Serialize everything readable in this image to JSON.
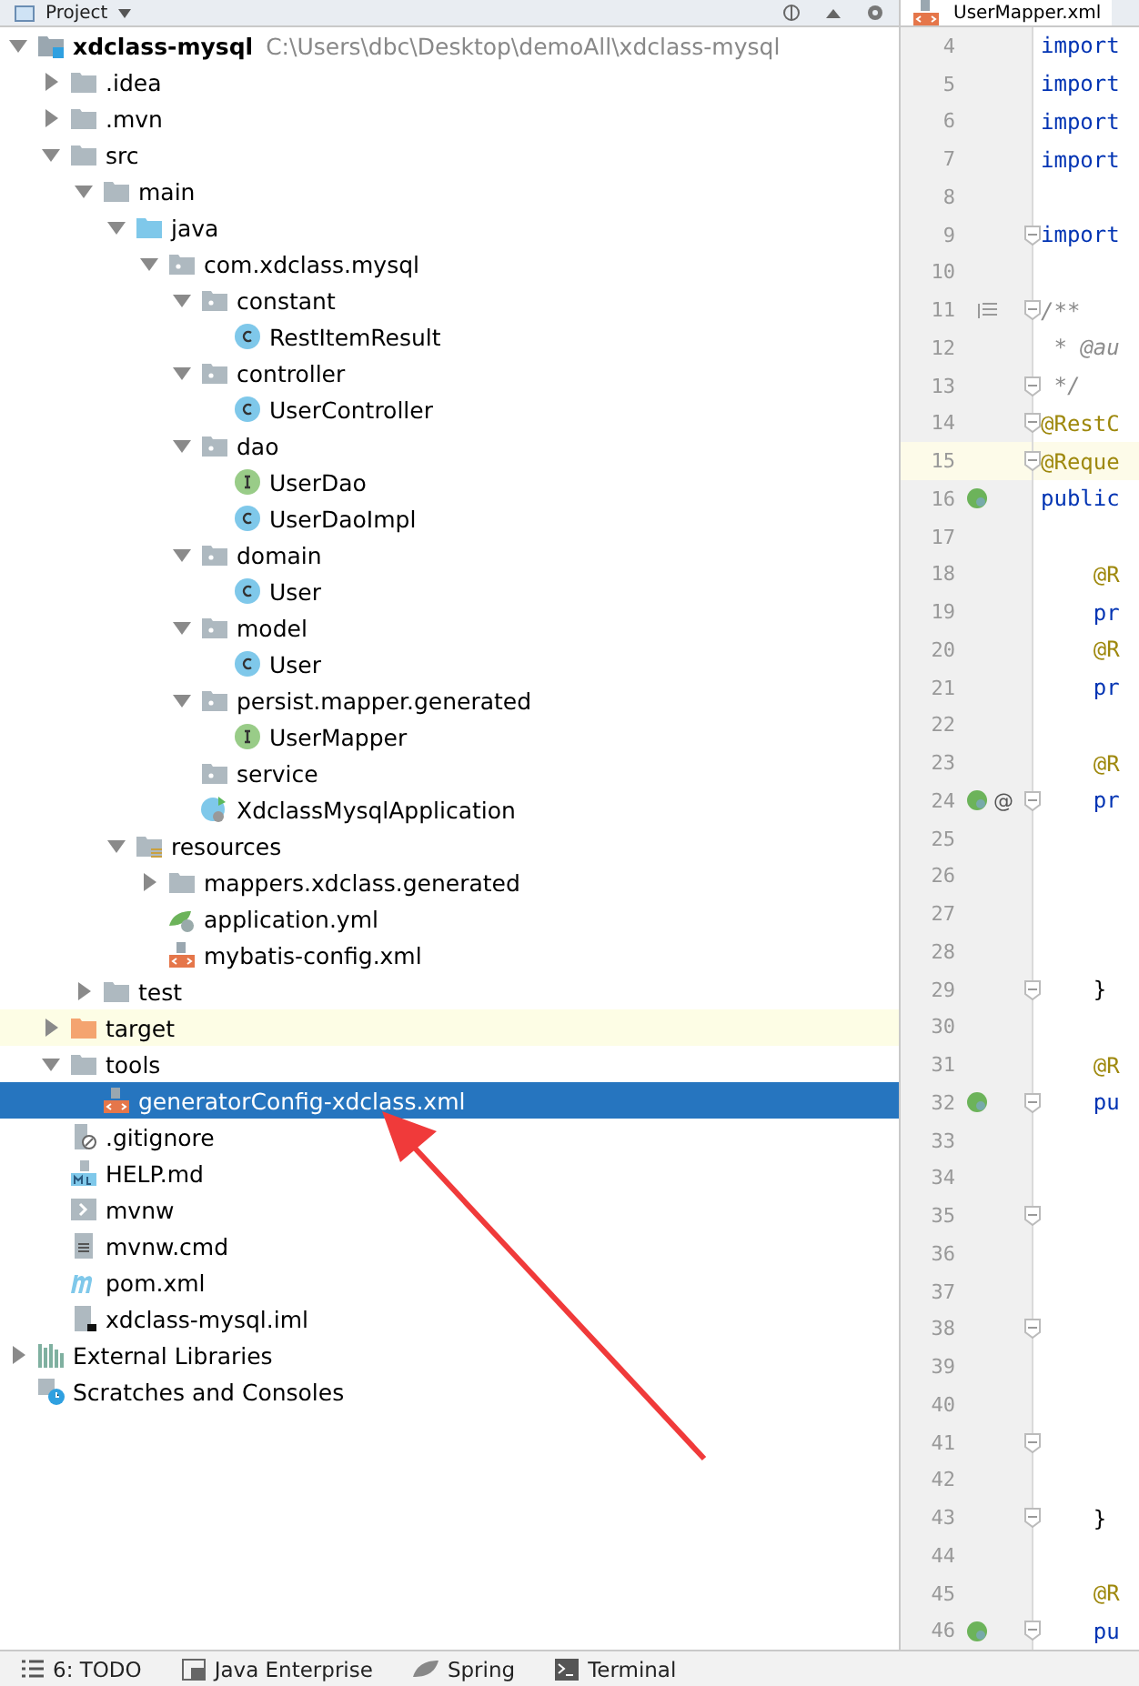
{
  "project_panel": {
    "title": "Project",
    "tree": [
      {
        "label": "xdclass-mysql",
        "path": "C:\\Users\\dbc\\Desktop\\demoAll\\xdclass-mysql",
        "kind": "module",
        "expanded": true,
        "selected": false,
        "highlighted": false,
        "children": [
          {
            "label": ".idea",
            "kind": "folder",
            "expanded": false,
            "selected": false,
            "highlighted": false
          },
          {
            "label": ".mvn",
            "kind": "folder",
            "expanded": false,
            "selected": false,
            "highlighted": false
          },
          {
            "label": "src",
            "kind": "folder",
            "expanded": true,
            "selected": false,
            "highlighted": false,
            "children": [
              {
                "label": "main",
                "kind": "folder",
                "expanded": true,
                "selected": false,
                "highlighted": false,
                "children": [
                  {
                    "label": "java",
                    "kind": "source-folder",
                    "expanded": true,
                    "selected": false,
                    "highlighted": false,
                    "children": [
                      {
                        "label": "com.xdclass.mysql",
                        "kind": "package",
                        "expanded": true,
                        "selected": false,
                        "highlighted": false,
                        "children": [
                          {
                            "label": "constant",
                            "kind": "package",
                            "expanded": true,
                            "selected": false,
                            "highlighted": false,
                            "children": [
                              {
                                "label": "RestItemResult",
                                "kind": "class",
                                "selected": false,
                                "highlighted": false
                              }
                            ]
                          },
                          {
                            "label": "controller",
                            "kind": "package",
                            "expanded": true,
                            "selected": false,
                            "highlighted": false,
                            "children": [
                              {
                                "label": "UserController",
                                "kind": "class",
                                "selected": false,
                                "highlighted": false
                              }
                            ]
                          },
                          {
                            "label": "dao",
                            "kind": "package",
                            "expanded": true,
                            "selected": false,
                            "highlighted": false,
                            "children": [
                              {
                                "label": "UserDao",
                                "kind": "interface",
                                "selected": false,
                                "highlighted": false
                              },
                              {
                                "label": "UserDaoImpl",
                                "kind": "class",
                                "selected": false,
                                "highlighted": false
                              }
                            ]
                          },
                          {
                            "label": "domain",
                            "kind": "package",
                            "expanded": true,
                            "selected": false,
                            "highlighted": false,
                            "children": [
                              {
                                "label": "User",
                                "kind": "class",
                                "selected": false,
                                "highlighted": false
                              }
                            ]
                          },
                          {
                            "label": "model",
                            "kind": "package",
                            "expanded": true,
                            "selected": false,
                            "highlighted": false,
                            "children": [
                              {
                                "label": "User",
                                "kind": "class",
                                "selected": false,
                                "highlighted": false
                              }
                            ]
                          },
                          {
                            "label": "persist.mapper.generated",
                            "kind": "package",
                            "expanded": true,
                            "selected": false,
                            "highlighted": false,
                            "children": [
                              {
                                "label": "UserMapper",
                                "kind": "interface",
                                "selected": false,
                                "highlighted": false
                              }
                            ]
                          },
                          {
                            "label": "service",
                            "kind": "package",
                            "selected": false,
                            "highlighted": false
                          },
                          {
                            "label": "XdclassMysqlApplication",
                            "kind": "spring-app",
                            "selected": false,
                            "highlighted": false
                          }
                        ]
                      }
                    ]
                  },
                  {
                    "label": "resources",
                    "kind": "resources-folder",
                    "expanded": true,
                    "selected": false,
                    "highlighted": false,
                    "children": [
                      {
                        "label": "mappers.xdclass.generated",
                        "kind": "folder",
                        "expanded": false,
                        "selected": false,
                        "highlighted": false
                      },
                      {
                        "label": "application.yml",
                        "kind": "spring-config",
                        "selected": false,
                        "highlighted": false
                      },
                      {
                        "label": "mybatis-config.xml",
                        "kind": "xml",
                        "selected": false,
                        "highlighted": false
                      }
                    ]
                  }
                ]
              },
              {
                "label": "test",
                "kind": "folder",
                "expanded": false,
                "selected": false,
                "highlighted": false
              }
            ]
          },
          {
            "label": "target",
            "kind": "excluded-folder",
            "expanded": false,
            "selected": false,
            "highlighted": true
          },
          {
            "label": "tools",
            "kind": "folder",
            "expanded": true,
            "selected": false,
            "highlighted": false,
            "children": [
              {
                "label": "generatorConfig-xdclass.xml",
                "kind": "xml",
                "selected": true,
                "highlighted": false
              }
            ]
          },
          {
            "label": ".gitignore",
            "kind": "gitignore",
            "selected": false,
            "highlighted": false
          },
          {
            "label": "HELP.md",
            "kind": "markdown",
            "selected": false,
            "highlighted": false
          },
          {
            "label": "mvnw",
            "kind": "shell",
            "selected": false,
            "highlighted": false
          },
          {
            "label": "mvnw.cmd",
            "kind": "text-file",
            "selected": false,
            "highlighted": false
          },
          {
            "label": "pom.xml",
            "kind": "maven",
            "selected": false,
            "highlighted": false
          },
          {
            "label": "xdclass-mysql.iml",
            "kind": "iml",
            "selected": false,
            "highlighted": false
          }
        ]
      },
      {
        "label": "External Libraries",
        "kind": "libraries",
        "expanded": false,
        "selected": false,
        "highlighted": false
      },
      {
        "label": "Scratches and Consoles",
        "kind": "scratches",
        "selected": false,
        "highlighted": false
      }
    ]
  },
  "editor": {
    "tab": "UserMapper.xml",
    "lines": [
      {
        "number": "4",
        "text": "import",
        "kind": "keyword",
        "current": false
      },
      {
        "number": "5",
        "text": "import",
        "kind": "keyword",
        "current": false
      },
      {
        "number": "6",
        "text": "import",
        "kind": "keyword",
        "current": false
      },
      {
        "number": "7",
        "text": "import",
        "kind": "keyword",
        "current": false
      },
      {
        "number": "8",
        "current": false
      },
      {
        "number": "9",
        "text": "import",
        "kind": "keyword",
        "fold": true,
        "current": false
      },
      {
        "number": "10",
        "current": false
      },
      {
        "number": "11",
        "text": "/**",
        "kind": "comment",
        "fold": true,
        "gutter": {
          "kind": "doc"
        },
        "current": false
      },
      {
        "number": "12",
        "text": " * *@au*",
        "kind": "doc",
        "current": false
      },
      {
        "number": "13",
        "text": " */",
        "kind": "comment",
        "fold": true,
        "current": false
      },
      {
        "number": "14",
        "text": "@RestC",
        "kind": "annotation",
        "fold": true,
        "current": false
      },
      {
        "number": "15",
        "text": "@Reque",
        "kind": "annotation",
        "fold": true,
        "current": true
      },
      {
        "number": "16",
        "text": "public",
        "kind": "keyword",
        "gutter": {
          "kind": "bean"
        },
        "current": false
      },
      {
        "number": "17",
        "current": false
      },
      {
        "number": "18",
        "text": "    @R",
        "kind": "annotation",
        "current": false
      },
      {
        "number": "19",
        "text": "    pr",
        "kind": "keyword",
        "current": false
      },
      {
        "number": "20",
        "text": "    @R",
        "kind": "annotation",
        "current": false
      },
      {
        "number": "21",
        "text": "    pr",
        "kind": "keyword",
        "current": false
      },
      {
        "number": "22",
        "current": false
      },
      {
        "number": "23",
        "text": "    @R",
        "kind": "annotation",
        "current": false
      },
      {
        "number": "24",
        "text": "    pr",
        "kind": "keyword",
        "fold": true,
        "gutter": {
          "kind": "bean",
          "text": "@"
        },
        "current": false
      },
      {
        "number": "25",
        "current": false
      },
      {
        "number": "26",
        "current": false
      },
      {
        "number": "27",
        "current": false
      },
      {
        "number": "28",
        "current": false
      },
      {
        "number": "29",
        "text": "    }",
        "kind": "brace",
        "fold": true,
        "current": false
      },
      {
        "number": "30",
        "current": false
      },
      {
        "number": "31",
        "text": "    @R",
        "kind": "annotation",
        "current": false
      },
      {
        "number": "32",
        "text": "    pu",
        "kind": "keyword",
        "fold": true,
        "gutter": {
          "kind": "bean"
        },
        "current": false
      },
      {
        "number": "33",
        "current": false
      },
      {
        "number": "34",
        "current": false
      },
      {
        "number": "35",
        "fold": true,
        "current": false
      },
      {
        "number": "36",
        "current": false
      },
      {
        "number": "37",
        "current": false
      },
      {
        "number": "38",
        "fold": true,
        "current": false
      },
      {
        "number": "39",
        "current": false
      },
      {
        "number": "40",
        "current": false
      },
      {
        "number": "41",
        "fold": true,
        "current": false
      },
      {
        "number": "42",
        "current": false
      },
      {
        "number": "43",
        "text": "    }",
        "kind": "brace",
        "fold": true,
        "current": false
      },
      {
        "number": "44",
        "current": false
      },
      {
        "number": "45",
        "text": "    @R",
        "kind": "annotation",
        "current": false
      },
      {
        "number": "46",
        "text": "    pu",
        "kind": "keyword",
        "fold": true,
        "gutter": {
          "kind": "bean"
        },
        "current": false
      }
    ]
  },
  "tool_window_bar": [
    {
      "label": "6: TODO",
      "kind": "todo"
    },
    {
      "label": "Java Enterprise",
      "kind": "javaee"
    },
    {
      "label": "Spring",
      "kind": "spring"
    },
    {
      "label": "Terminal",
      "kind": "terminal"
    }
  ]
}
